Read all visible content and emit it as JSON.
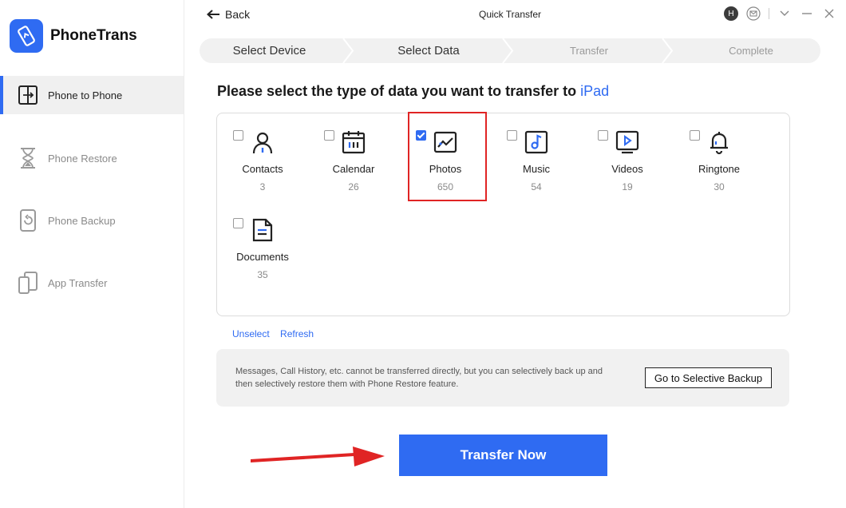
{
  "app": {
    "name": "PhoneTrans"
  },
  "sidebar": {
    "items": [
      {
        "label": "Phone to Phone",
        "icon": "phone-to-phone-icon",
        "active": true
      },
      {
        "label": "Phone Restore",
        "icon": "hourglass-icon",
        "active": false
      },
      {
        "label": "Phone Backup",
        "icon": "backup-icon",
        "active": false
      },
      {
        "label": "App Transfer",
        "icon": "app-transfer-icon",
        "active": false
      }
    ]
  },
  "header": {
    "back_label": "Back",
    "title": "Quick Transfer",
    "avatar_initial": "H"
  },
  "steps": [
    {
      "label": "Select Device",
      "state": "done"
    },
    {
      "label": "Select Data",
      "state": "current"
    },
    {
      "label": "Transfer",
      "state": "todo"
    },
    {
      "label": "Complete",
      "state": "todo"
    }
  ],
  "main": {
    "heading_prefix": "Please select the type of data you want to transfer to ",
    "target_device": "iPad",
    "data_types": [
      {
        "label": "Contacts",
        "count": "3",
        "checked": false,
        "icon": "contacts-icon"
      },
      {
        "label": "Calendar",
        "count": "26",
        "checked": false,
        "icon": "calendar-icon"
      },
      {
        "label": "Photos",
        "count": "650",
        "checked": true,
        "icon": "photos-icon"
      },
      {
        "label": "Music",
        "count": "54",
        "checked": false,
        "icon": "music-icon"
      },
      {
        "label": "Videos",
        "count": "19",
        "checked": false,
        "icon": "videos-icon"
      },
      {
        "label": "Ringtone",
        "count": "30",
        "checked": false,
        "icon": "bell-icon"
      },
      {
        "label": "Documents",
        "count": "35",
        "checked": false,
        "icon": "documents-icon"
      }
    ],
    "unselect_label": "Unselect",
    "refresh_label": "Refresh",
    "notice_text": "Messages, Call History, etc. cannot be transferred directly, but you can selectively back up and then selectively restore them with Phone Restore feature.",
    "selective_backup_label": "Go to Selective Backup",
    "transfer_button_label": "Transfer Now"
  },
  "colors": {
    "accent": "#2f6bf2",
    "highlight": "#e02424"
  }
}
